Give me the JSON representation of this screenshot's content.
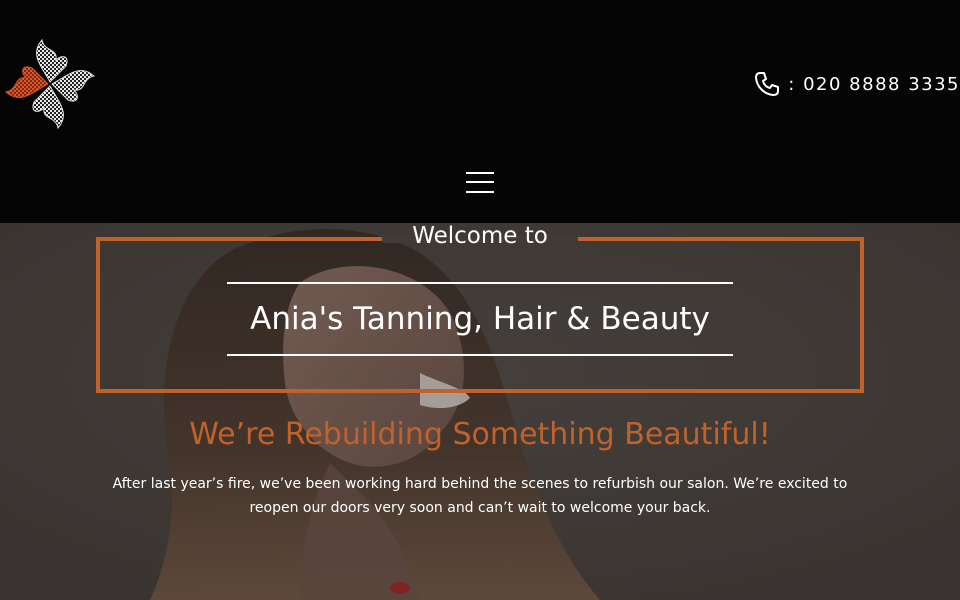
{
  "brand": {
    "logo_icon": "pinwheel-logo-icon",
    "accent_color": "#c0622a"
  },
  "header": {
    "phone_icon": "phone-icon",
    "phone": " : 020 8888 3335",
    "menu_icon": "hamburger-menu-icon"
  },
  "hero": {
    "welcome": "Welcome to",
    "salon_name": "Ania's Tanning, Hair & Beauty",
    "headline": "We’re Rebuilding Something Beautiful!",
    "body": "After last year’s fire, we’ve been working hard behind the scenes to refurbish our salon. We’re excited to reopen our doors very soon and can’t wait to welcome your back."
  }
}
